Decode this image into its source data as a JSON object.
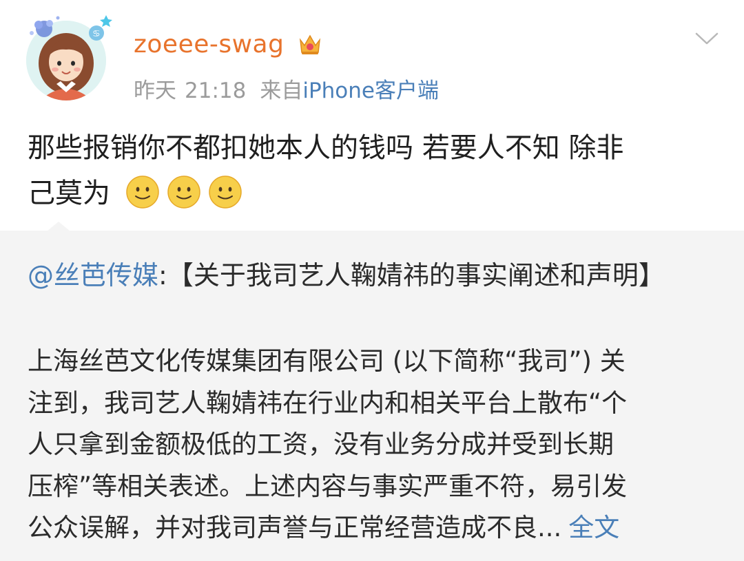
{
  "post": {
    "username": "zoeee-swag",
    "badge_icon": "vip-crown-icon",
    "avatar_icon": "cartoon-girl-avatar",
    "date": "昨天",
    "time": "21:18",
    "from_label": "来自",
    "client": "iPhone客户端",
    "text_line1": "那些报销你不都扣她本人的钱吗  若要人不知 除非",
    "text_line2": "己莫为",
    "emojis": [
      "smile-emoji",
      "smile-emoji",
      "smile-emoji"
    ],
    "menu_icon": "chevron-down-icon"
  },
  "repost": {
    "mention": "@丝芭传媒",
    "colon": ":",
    "title": "【关于我司艺人鞠婧祎的事实阐述和声明】",
    "lines": [
      "上海丝芭文化传媒集团有限公司 (以下简称“我司”) 关",
      "注到，我司艺人鞠婧祎在行业内和相关平台上散布“个",
      "人只拿到金额极低的工资，没有业务分成并受到长期",
      "压榨”等相关表述。上述内容与事实严重不符，易引发",
      "公众误解，并对我司声誉与正常经营造成不良..."
    ],
    "full_text_link": "全文"
  },
  "colors": {
    "username": "#e8732c",
    "link": "#4a7fb8",
    "meta": "#9b9b9b",
    "repost_bg": "#f4f4f4"
  }
}
